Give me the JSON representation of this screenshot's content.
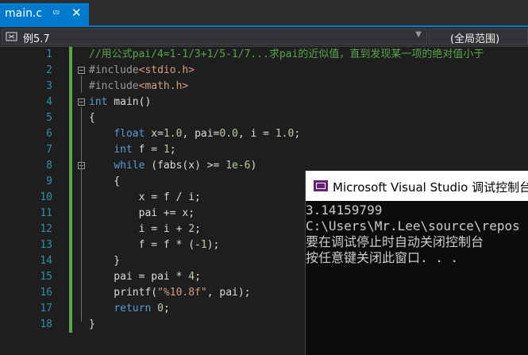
{
  "tab": {
    "title": "main.c",
    "pin_icon": "pin-icon",
    "close_icon": "close-icon"
  },
  "navbar": {
    "scope": "例5.7",
    "global_scope": "(全局范围)"
  },
  "editor": {
    "line_numbers": [
      "1",
      "2",
      "3",
      "4",
      "5",
      "6",
      "7",
      "8",
      "9",
      "10",
      "11",
      "12",
      "13",
      "14",
      "15",
      "16",
      "17",
      "18"
    ],
    "lines": [
      "//用公式pai/4=1-1/3+1/5-1/7...求pai的近似值，直到发现某一项的绝对值小于",
      "#include<stdio.h>",
      "#include<math.h>",
      "int main()",
      "{",
      "    float x=1.0, pai=0.0, i = 1.0;",
      "    int f = 1;",
      "    while (fabs(x) >= 1e-6)",
      "    {",
      "        x = f / i;",
      "        pai += x;",
      "        i = i + 2;",
      "        f = f * (-1);",
      "    }",
      "    pai = pai * 4;",
      "    printf(\"%10.8f\", pai);",
      "    return 0;",
      "}"
    ]
  },
  "console": {
    "title": "Microsoft Visual Studio 调试控制台",
    "output": [
      "3.14159799",
      "C:\\Users\\Mr.Lee\\source\\repos",
      "要在调试停止时自动关闭控制台",
      "按任意键关闭此窗口. . ."
    ]
  },
  "colors": {
    "accent": "#007acc",
    "editor_bg": "#1e1e1e",
    "keyword": "#569cd6",
    "comment": "#57a64a"
  }
}
